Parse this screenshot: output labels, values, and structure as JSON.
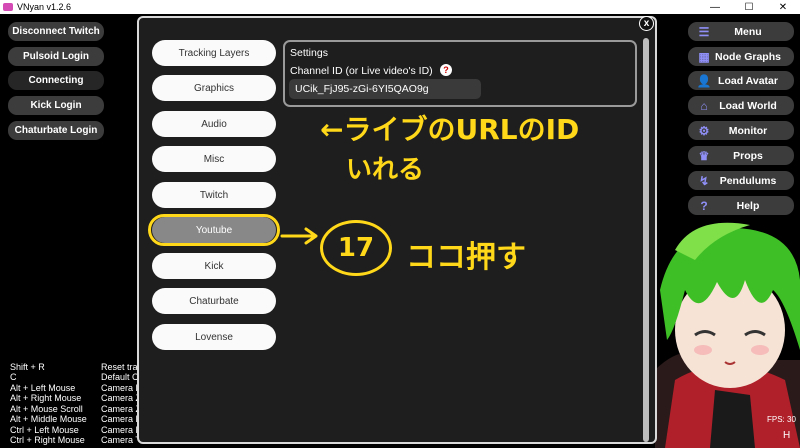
{
  "window": {
    "title": "VNyan v1.2.6",
    "minimize": "—",
    "maximize": "☐",
    "close": "✕"
  },
  "left_buttons": [
    {
      "label": "Disconnect Twitch"
    },
    {
      "label": "Pulsoid Login"
    },
    {
      "label": "Connecting"
    },
    {
      "label": "Kick Login"
    },
    {
      "label": "Chaturbate Login"
    }
  ],
  "right_buttons": [
    {
      "label": "Menu",
      "icon": "hamburger-icon",
      "glyph": "☰"
    },
    {
      "label": "Node Graphs",
      "icon": "grid-icon",
      "glyph": "▦"
    },
    {
      "label": "Load Avatar",
      "icon": "user-icon",
      "glyph": "👤"
    },
    {
      "label": "Load World",
      "icon": "house-icon",
      "glyph": "⌂"
    },
    {
      "label": "Monitor",
      "icon": "gear-icon",
      "glyph": "⚙"
    },
    {
      "label": "Props",
      "icon": "crown-icon",
      "glyph": "♛"
    },
    {
      "label": "Pendulums",
      "icon": "pendulum-icon",
      "glyph": "↯"
    },
    {
      "label": "Help",
      "icon": "question-icon",
      "glyph": "?"
    }
  ],
  "dialog": {
    "close_label": "x",
    "tabs": [
      {
        "label": "Tracking Layers"
      },
      {
        "label": "Graphics"
      },
      {
        "label": "Audio"
      },
      {
        "label": "Misc"
      },
      {
        "label": "Twitch"
      },
      {
        "label": "Youtube"
      },
      {
        "label": "Kick"
      },
      {
        "label": "Chaturbate"
      },
      {
        "label": "Lovense"
      }
    ],
    "active_tab": "Youtube",
    "settings_title": "Settings",
    "channel_label": "Channel ID (or Live video's ID)",
    "help_label": "?",
    "channel_value": "UCik_FjJ95-zGi-6YI5QAO9g"
  },
  "annotations": {
    "line1": "←ライブのURLのID",
    "line2": "いれる",
    "step_number": "17",
    "press_here": "ココ押す",
    "color": "#ffd81a"
  },
  "shortcuts": [
    {
      "key": "Shift + R",
      "action": "Reset tracking"
    },
    {
      "key": "C",
      "action": "Default Camera"
    },
    {
      "key": "Alt + Left Mouse",
      "action": "Camera Rotate"
    },
    {
      "key": "Alt + Right Mouse",
      "action": "Camera Zoom"
    },
    {
      "key": "Alt + Mouse Scroll",
      "action": "Camera Zoom"
    },
    {
      "key": "Alt + Middle Mouse",
      "action": "Camera Move"
    },
    {
      "key": "Ctrl + Left Mouse",
      "action": "Camera Move"
    },
    {
      "key": "Ctrl + Right Mouse",
      "action": "Camera Tilt"
    }
  ],
  "status": {
    "fps": "FPS: 30",
    "hide_label": "H"
  },
  "colors": {
    "accent_icon": "#8f8ff7",
    "dialog_bg": "#1e1e1e",
    "button_bg": "#3c3c3c"
  }
}
